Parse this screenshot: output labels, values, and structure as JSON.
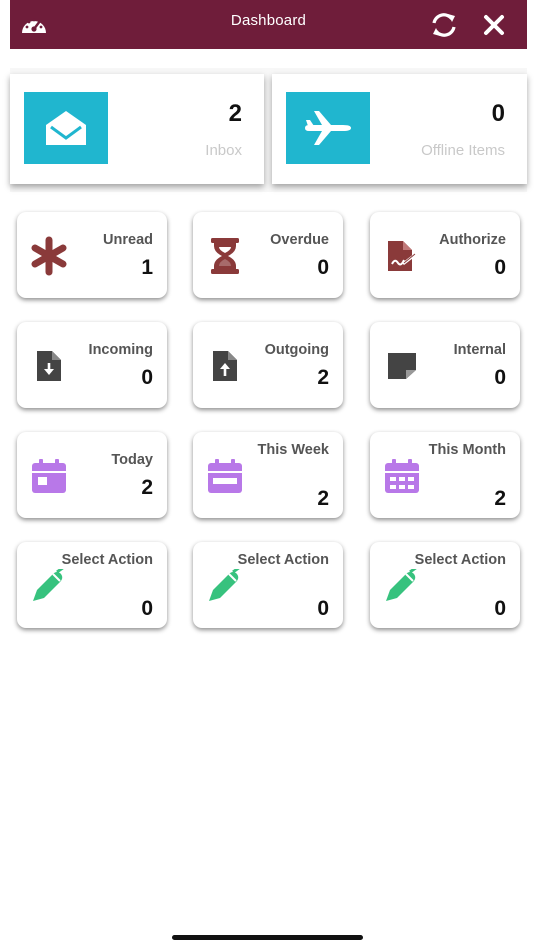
{
  "header": {
    "title": "Dashboard",
    "bg": "#6f1d3a"
  },
  "summary": [
    {
      "value": "2",
      "label": "Inbox",
      "icon": "envelope-open-icon"
    },
    {
      "value": "0",
      "label": "Offline Items",
      "icon": "airplane-icon"
    }
  ],
  "tiles": [
    {
      "label": "Unread",
      "value": "1",
      "icon": "asterisk-icon"
    },
    {
      "label": "Overdue",
      "value": "0",
      "icon": "hourglass-icon"
    },
    {
      "label": "Authorize",
      "value": "0",
      "icon": "signed-document-icon"
    },
    {
      "label": "Incoming",
      "value": "0",
      "icon": "file-download-icon"
    },
    {
      "label": "Outgoing",
      "value": "2",
      "icon": "file-upload-icon"
    },
    {
      "label": "Internal",
      "value": "0",
      "icon": "sticky-note-icon"
    },
    {
      "label": "Today",
      "value": "2",
      "icon": "calendar-day-icon"
    },
    {
      "label": "This Week",
      "value": "2",
      "icon": "calendar-week-icon"
    },
    {
      "label": "This Month",
      "value": "2",
      "icon": "calendar-month-icon"
    },
    {
      "label": "Select Action",
      "value": "0",
      "icon": "pen-icon"
    },
    {
      "label": "Select Action",
      "value": "0",
      "icon": "pen-icon"
    },
    {
      "label": "Select Action",
      "value": "0",
      "icon": "pen-icon"
    }
  ],
  "colors": {
    "accent_tile": "#20b6cf",
    "icon_maroon": "#8a3a3a",
    "icon_dark": "#444444",
    "icon_purple": "#b878e8",
    "icon_green": "#37c27e"
  }
}
